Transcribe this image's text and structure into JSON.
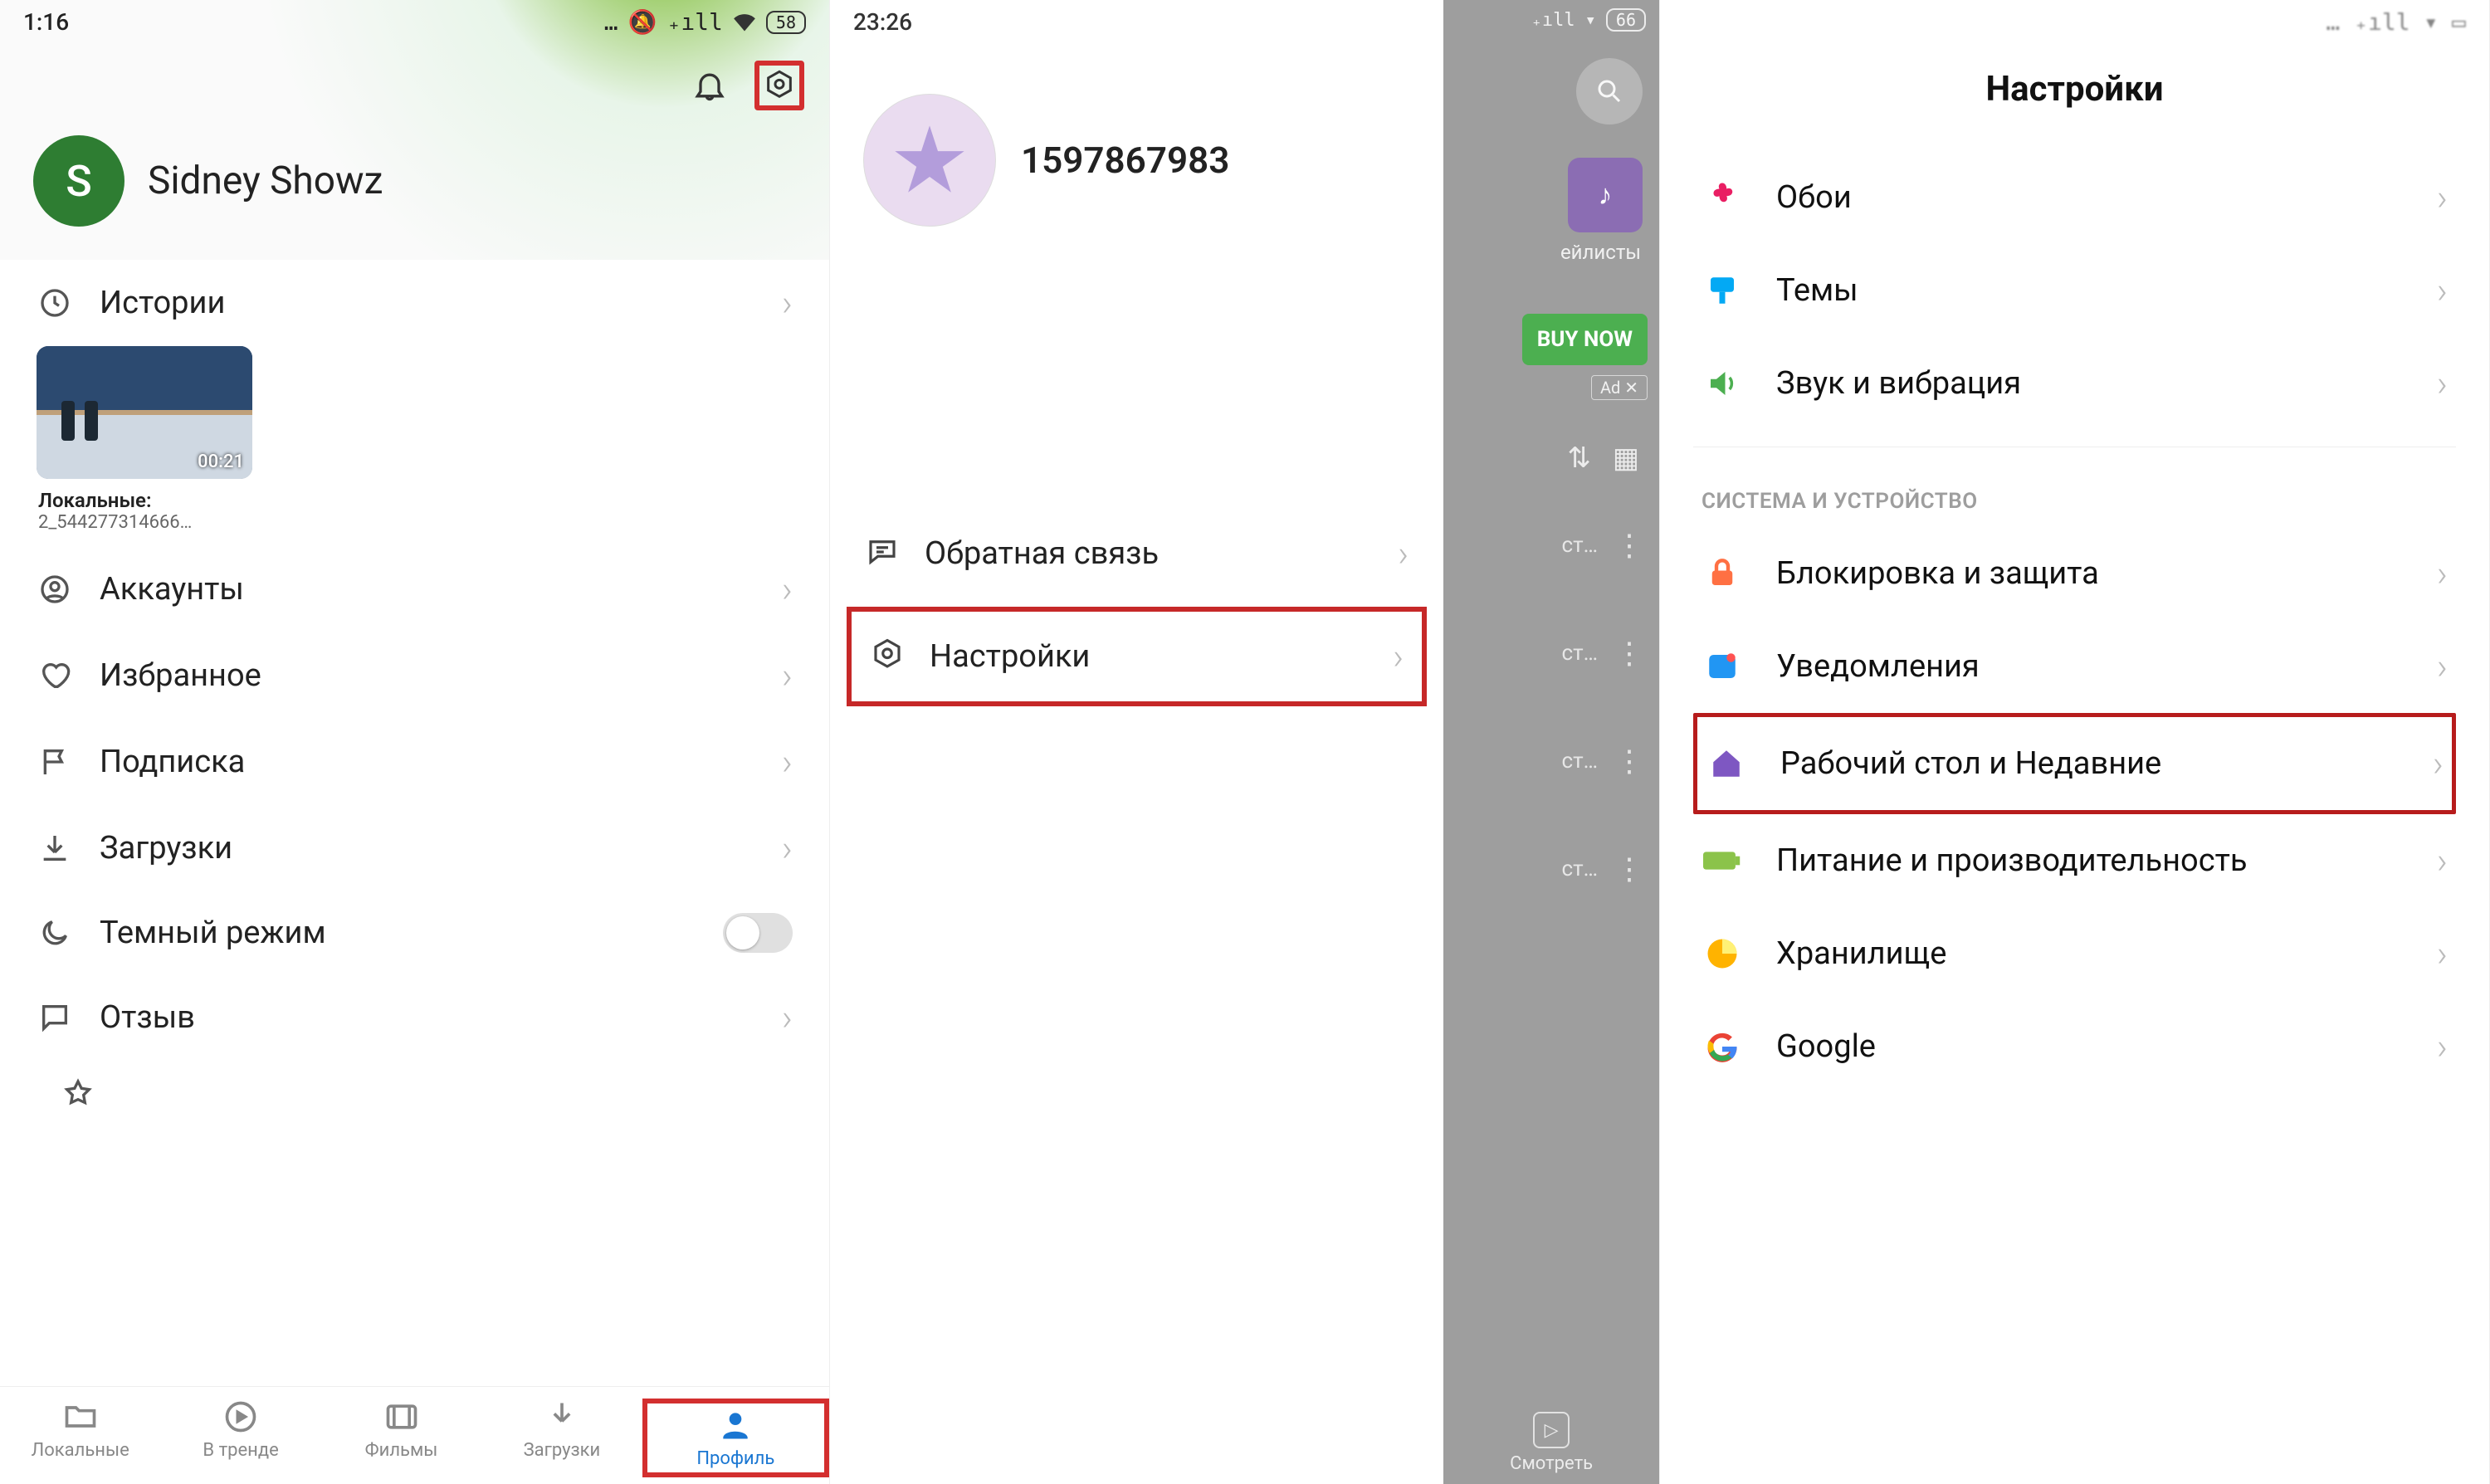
{
  "screen1": {
    "status": {
      "time": "1:16",
      "battery": "58",
      "icons": "… ⨉ ₊ıl 📶"
    },
    "user": {
      "initial": "S",
      "name": "Sidney Showz"
    },
    "rows": {
      "history": "Истории",
      "accounts": "Аккаунты",
      "favorites": "Избранное",
      "subscription": "Подписка",
      "downloads": "Загрузки",
      "darkmode": "Темный режим",
      "review": "Отзыв"
    },
    "thumb": {
      "duration": "00:21",
      "caption": "Локальные:",
      "filename": "2_544277314666…"
    },
    "nav": {
      "local": "Локальные",
      "trending": "В тренде",
      "movies": "Фильмы",
      "downloads": "Загрузки",
      "profile": "Профиль"
    }
  },
  "screen2": {
    "status": {
      "time": "23:26",
      "battery": "66"
    },
    "uid": "1597867983",
    "menu": {
      "feedback": "Обратная связь",
      "settings": "Настройки"
    },
    "dim": {
      "playlists": "ейлисты",
      "buy": "BUY NOW",
      "ad": "Ad ✕",
      "row": "ст…",
      "watch": "Смотреть"
    }
  },
  "screen3": {
    "title": "Настройки",
    "section": "СИСТЕМА И УСТРОЙСТВО",
    "rows": {
      "wallpaper": "Обои",
      "themes": "Темы",
      "sound": "Звук и вибрация",
      "lock": "Блокировка и защита",
      "notif": "Уведомления",
      "home": "Рабочий стол и Недавние",
      "power": "Питание и производительность",
      "storage": "Хранилище",
      "google": "Google"
    },
    "colors": {
      "wallpaper": "#e91e63",
      "themes": "#03a9f4",
      "sound": "#4caf50",
      "lock": "#ff7043",
      "notif": "#2196f3",
      "home": "#7e57c2",
      "power": "#8bc34a",
      "storage": "#ffb300"
    }
  }
}
